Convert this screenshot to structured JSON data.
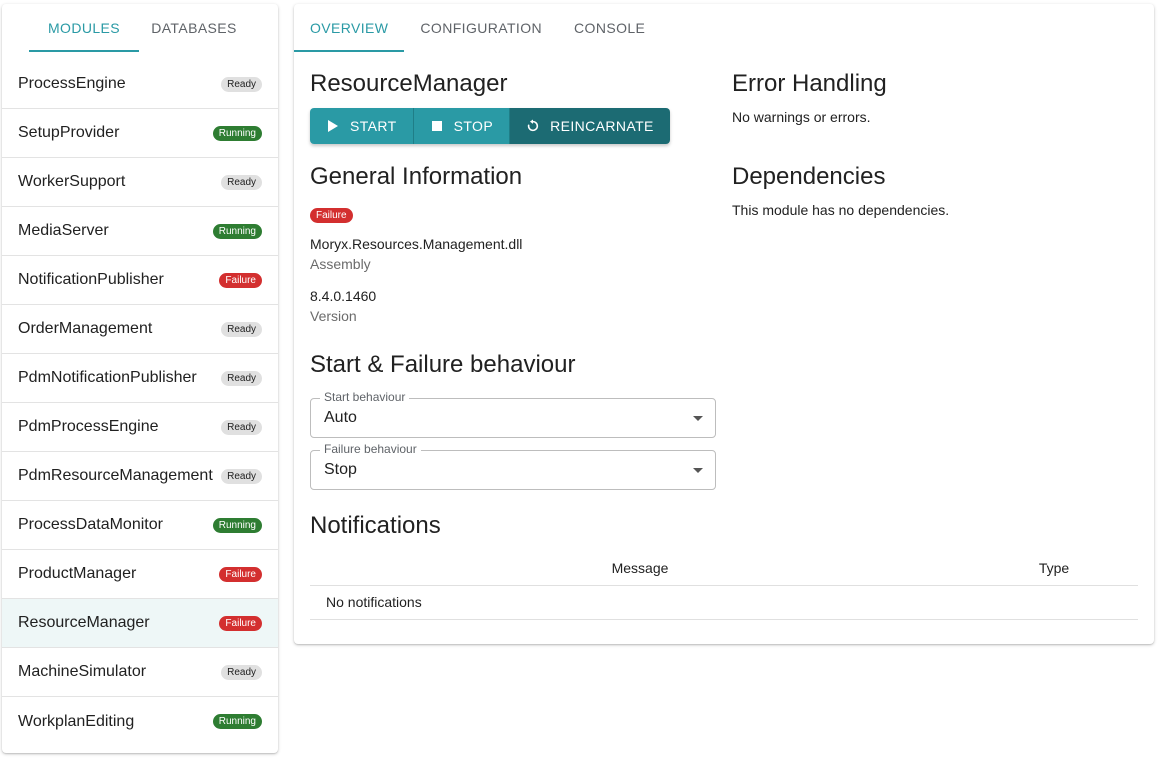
{
  "sidebar": {
    "tabs": [
      {
        "label": "MODULES",
        "active": true
      },
      {
        "label": "DATABASES",
        "active": false
      }
    ],
    "modules": [
      {
        "name": "ProcessEngine",
        "status": "Ready",
        "status_kind": "ready"
      },
      {
        "name": "SetupProvider",
        "status": "Running",
        "status_kind": "running"
      },
      {
        "name": "WorkerSupport",
        "status": "Ready",
        "status_kind": "ready"
      },
      {
        "name": "MediaServer",
        "status": "Running",
        "status_kind": "running"
      },
      {
        "name": "NotificationPublisher",
        "status": "Failure",
        "status_kind": "failure"
      },
      {
        "name": "OrderManagement",
        "status": "Ready",
        "status_kind": "ready"
      },
      {
        "name": "PdmNotificationPublisher",
        "status": "Ready",
        "status_kind": "ready"
      },
      {
        "name": "PdmProcessEngine",
        "status": "Ready",
        "status_kind": "ready"
      },
      {
        "name": "PdmResourceManagement",
        "status": "Ready",
        "status_kind": "ready"
      },
      {
        "name": "ProcessDataMonitor",
        "status": "Running",
        "status_kind": "running"
      },
      {
        "name": "ProductManager",
        "status": "Failure",
        "status_kind": "failure"
      },
      {
        "name": "ResourceManager",
        "status": "Failure",
        "status_kind": "failure",
        "selected": true
      },
      {
        "name": "MachineSimulator",
        "status": "Ready",
        "status_kind": "ready"
      },
      {
        "name": "WorkplanEditing",
        "status": "Running",
        "status_kind": "running"
      }
    ]
  },
  "main": {
    "tabs": [
      {
        "label": "OVERVIEW",
        "active": true
      },
      {
        "label": "CONFIGURATION",
        "active": false
      },
      {
        "label": "CONSOLE",
        "active": false
      }
    ],
    "module_title": "ResourceManager",
    "buttons": {
      "start": "START",
      "stop": "STOP",
      "reincarnate": "REINCARNATE"
    },
    "general_heading": "General Information",
    "state_badge": "Failure",
    "assembly_value": "Moryx.Resources.Management.dll",
    "assembly_label": "Assembly",
    "version_value": "8.4.0.1460",
    "version_label": "Version",
    "behaviour_heading": "Start & Failure behaviour",
    "start_behaviour": {
      "label": "Start behaviour",
      "value": "Auto"
    },
    "failure_behaviour": {
      "label": "Failure behaviour",
      "value": "Stop"
    },
    "error_heading": "Error Handling",
    "error_text": "No warnings or errors.",
    "dependencies_heading": "Dependencies",
    "dependencies_text": "This module has no dependencies.",
    "notifications_heading": "Notifications",
    "notifications_table": {
      "columns": [
        "Message",
        "Type"
      ],
      "empty_text": "No notifications"
    }
  },
  "colors": {
    "accent": "#2a9aa5",
    "running": "#2e7d32",
    "failure": "#d32f2f",
    "ready": "#e0e0e0"
  }
}
